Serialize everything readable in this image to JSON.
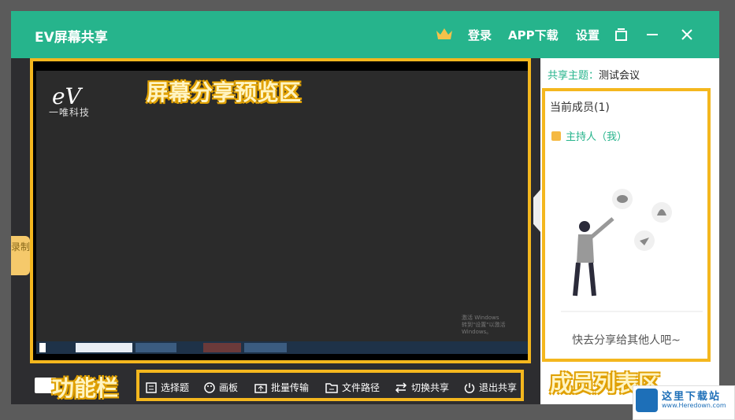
{
  "titlebar": {
    "title": "EV屏幕共享",
    "login": "登录",
    "app_download": "APP下载",
    "settings": "设置"
  },
  "preview": {
    "logo": "eV",
    "logo_sub": "一唯科技",
    "annotation": "屏幕分享预览区",
    "watermark_line1": "激活 Windows",
    "watermark_line2": "转到\"设置\"以激活 Windows。"
  },
  "side": {
    "record": "录制"
  },
  "right_panel": {
    "topic_label": "共享主题：",
    "topic_value": "测试会议",
    "members_title": "当前成员(1)",
    "host": "主持人（我）",
    "share_hint": "快去分享给其他人吧~",
    "annotation": "成员列表区"
  },
  "bottom": {
    "annotation": "功能栏",
    "buttons": [
      {
        "label": "选择题",
        "icon": "list-icon"
      },
      {
        "label": "画板",
        "icon": "palette-icon"
      },
      {
        "label": "批量传输",
        "icon": "upload-icon"
      },
      {
        "label": "文件路径",
        "icon": "folder-icon"
      },
      {
        "label": "切换共享",
        "icon": "switch-icon"
      },
      {
        "label": "退出共享",
        "icon": "power-icon"
      }
    ]
  },
  "badge": {
    "name": "这里下载站",
    "url": "www.Heredown.com"
  },
  "colors": {
    "brand": "#26b48c",
    "highlight": "#f4b71e"
  }
}
